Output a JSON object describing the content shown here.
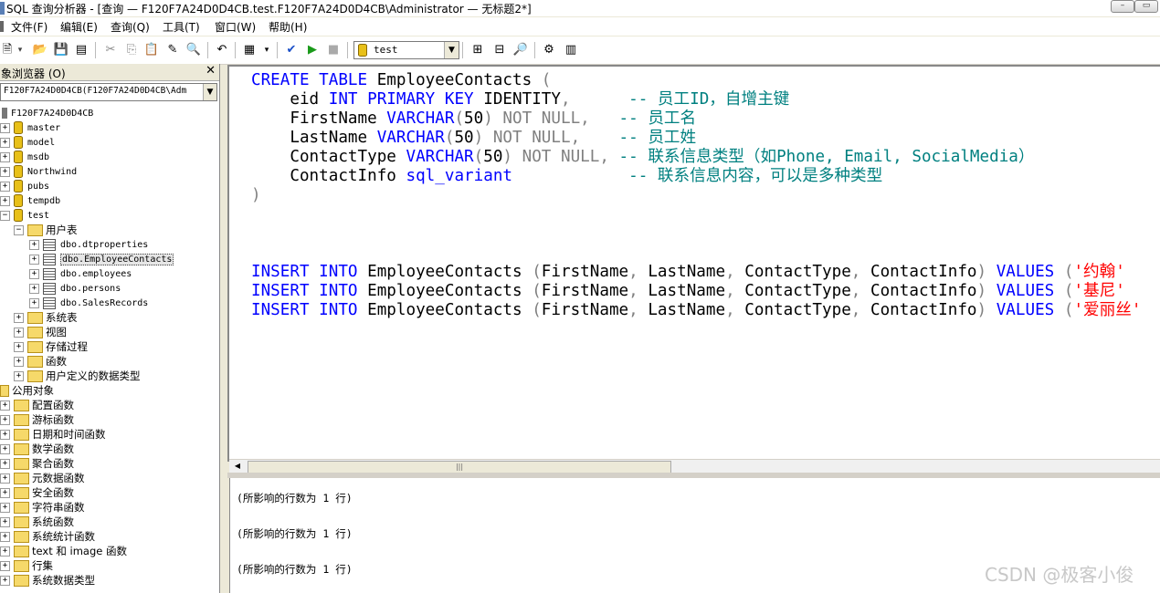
{
  "window": {
    "title": "SQL 查询分析器 - [查询 — F120F7A24D0D4CB.test.F120F7A24D0D4CB\\Administrator — 无标题2*]"
  },
  "menu": {
    "items": [
      "文件(F)",
      "编辑(E)",
      "查询(Q)",
      "工具(T)",
      "窗口(W)",
      "帮助(H)"
    ]
  },
  "toolbar": {
    "database": "test"
  },
  "object_browser": {
    "title": "象浏览器 (O)",
    "close": "✕",
    "combo_value": "F120F7A24D0D4CB(F120F7A24D0D4CB\\Adm",
    "server": "F120F7A24D0D4CB",
    "databases": [
      "master",
      "model",
      "msdb",
      "Northwind",
      "pubs",
      "tempdb",
      "test"
    ],
    "test_children": {
      "user_tables_folder": "用户表",
      "tables": [
        "dbo.dtproperties",
        "dbo.EmployeeContacts",
        "dbo.employees",
        "dbo.persons",
        "dbo.SalesRecords"
      ],
      "folders": [
        "系统表",
        "视图",
        "存储过程",
        "函数",
        "用户定义的数据类型"
      ]
    },
    "common_objects": "公用对象",
    "common_folders": [
      "配置函数",
      "游标函数",
      "日期和时间函数",
      "数学函数",
      "聚合函数",
      "元数据函数",
      "安全函数",
      "字符串函数",
      "系统函数",
      "系统统计函数",
      "text 和 image 函数",
      "行集",
      "系统数据类型"
    ]
  },
  "editor": {
    "lines": [
      [
        {
          "t": "CREATE TABLE",
          "c": "kw"
        },
        {
          "t": " EmployeeContacts ",
          "c": ""
        },
        {
          "t": "(",
          "c": "gr"
        }
      ],
      [
        {
          "t": "    eid ",
          "c": ""
        },
        {
          "t": "INT PRIMARY KEY",
          "c": "kw"
        },
        {
          "t": " IDENTITY",
          "c": ""
        },
        {
          "t": ",",
          "c": "gr"
        },
        {
          "t": "      -- 员工ID，自增主键",
          "c": "cm"
        }
      ],
      [
        {
          "t": "    FirstName ",
          "c": ""
        },
        {
          "t": "VARCHAR",
          "c": "kw"
        },
        {
          "t": "(",
          "c": "gr"
        },
        {
          "t": "50",
          "c": ""
        },
        {
          "t": ") NOT NULL,",
          "c": "gr"
        },
        {
          "t": "   -- 员工名",
          "c": "cm"
        }
      ],
      [
        {
          "t": "    LastName ",
          "c": ""
        },
        {
          "t": "VARCHAR",
          "c": "kw"
        },
        {
          "t": "(",
          "c": "gr"
        },
        {
          "t": "50",
          "c": ""
        },
        {
          "t": ") NOT NULL,",
          "c": "gr"
        },
        {
          "t": "    -- 员工姓",
          "c": "cm"
        }
      ],
      [
        {
          "t": "    ContactType ",
          "c": ""
        },
        {
          "t": "VARCHAR",
          "c": "kw"
        },
        {
          "t": "(",
          "c": "gr"
        },
        {
          "t": "50",
          "c": ""
        },
        {
          "t": ") NOT NULL,",
          "c": "gr"
        },
        {
          "t": " -- 联系信息类型（如Phone, Email, SocialMedia）",
          "c": "cm"
        }
      ],
      [
        {
          "t": "    ContactInfo ",
          "c": ""
        },
        {
          "t": "sql_variant",
          "c": "kw"
        },
        {
          "t": "            -- 联系信息内容，可以是多种类型",
          "c": "cm"
        }
      ],
      [
        {
          "t": ")",
          "c": "gr"
        }
      ],
      [
        {
          "t": "",
          "c": ""
        }
      ],
      [
        {
          "t": "",
          "c": ""
        }
      ],
      [
        {
          "t": "",
          "c": ""
        }
      ],
      [
        {
          "t": "INSERT INTO",
          "c": "kw"
        },
        {
          "t": " EmployeeContacts ",
          "c": ""
        },
        {
          "t": "(",
          "c": "gr"
        },
        {
          "t": "FirstName",
          "c": ""
        },
        {
          "t": ", ",
          "c": "gr"
        },
        {
          "t": "LastName",
          "c": ""
        },
        {
          "t": ", ",
          "c": "gr"
        },
        {
          "t": "ContactType",
          "c": ""
        },
        {
          "t": ", ",
          "c": "gr"
        },
        {
          "t": "ContactInfo",
          "c": ""
        },
        {
          "t": ") ",
          "c": "gr"
        },
        {
          "t": "VALUES",
          "c": "kw"
        },
        {
          "t": " (",
          "c": "gr"
        },
        {
          "t": "'约翰'",
          "c": "st"
        }
      ],
      [
        {
          "t": "INSERT INTO",
          "c": "kw"
        },
        {
          "t": " EmployeeContacts ",
          "c": ""
        },
        {
          "t": "(",
          "c": "gr"
        },
        {
          "t": "FirstName",
          "c": ""
        },
        {
          "t": ", ",
          "c": "gr"
        },
        {
          "t": "LastName",
          "c": ""
        },
        {
          "t": ", ",
          "c": "gr"
        },
        {
          "t": "ContactType",
          "c": ""
        },
        {
          "t": ", ",
          "c": "gr"
        },
        {
          "t": "ContactInfo",
          "c": ""
        },
        {
          "t": ") ",
          "c": "gr"
        },
        {
          "t": "VALUES",
          "c": "kw"
        },
        {
          "t": " (",
          "c": "gr"
        },
        {
          "t": "'基尼'",
          "c": "st"
        }
      ],
      [
        {
          "t": "INSERT INTO",
          "c": "kw"
        },
        {
          "t": " EmployeeContacts ",
          "c": ""
        },
        {
          "t": "(",
          "c": "gr"
        },
        {
          "t": "FirstName",
          "c": ""
        },
        {
          "t": ", ",
          "c": "gr"
        },
        {
          "t": "LastName",
          "c": ""
        },
        {
          "t": ", ",
          "c": "gr"
        },
        {
          "t": "ContactType",
          "c": ""
        },
        {
          "t": ", ",
          "c": "gr"
        },
        {
          "t": "ContactInfo",
          "c": ""
        },
        {
          "t": ") ",
          "c": "gr"
        },
        {
          "t": "VALUES",
          "c": "kw"
        },
        {
          "t": " (",
          "c": "gr"
        },
        {
          "t": "'爱丽丝'",
          "c": "st"
        }
      ]
    ]
  },
  "results": {
    "lines": [
      "(所影响的行数为 1 行)",
      "(所影响的行数为 1 行)",
      "(所影响的行数为 1 行)"
    ]
  },
  "watermark": "CSDN @极客小俊",
  "colors": {
    "keyword": "#0000ff",
    "comment": "#008080",
    "operator": "#808080",
    "string": "#ff0000"
  },
  "icons": {
    "toolbar": [
      "new-query-icon",
      "open-file-icon",
      "save-icon",
      "load-script-icon",
      "cut-icon",
      "copy-icon",
      "paste-icon",
      "clear-window-icon",
      "find-icon",
      "undo-icon",
      "results-mode-icon",
      "parse-check-icon",
      "execute-icon",
      "stop-icon",
      "object-browser-icon",
      "object-search-icon",
      "plan-icon",
      "options-icon",
      "grid-icon"
    ]
  }
}
